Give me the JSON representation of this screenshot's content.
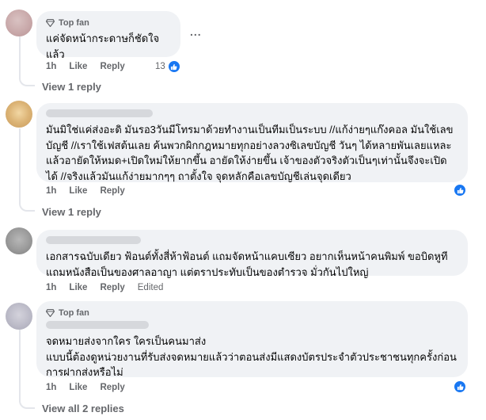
{
  "comments": [
    {
      "badge": "Top fan",
      "text": "แค่จัดหน้ากระดาษก็ชัดใจแล้ว",
      "time": "1h",
      "like": "Like",
      "reply": "Reply",
      "reactions": "13",
      "more": "..."
    },
    {
      "text": "มันมิใช่แค่ส่งอะดิ มันรอ3วันมีโทรมาด้วยทำงานเป็นทีมเป็นระบบ //แก้ง่ายๆแก๊งคอล มันใช้เลขบัญชี //เราใช้เฟสต้นเลย ค้นพวกผิกกฎหมายทุกอย่างลวงซิเลขบัญชี วันๆ ได้หลายพันเลยแหละ แล้วอายัดให้หมด+เปิดใหม่ให้ยากขึ้น อายัดให้ง่ายขึ้น เจ้าของตัวจริงตัวเป็นๆเท่านั้นจึงจะเปิดได้ //จริงแล้วมันแก้ง่ายมากๆๆ ถาตั้งใจ จุดหลักคือเลขบัญชีเล่นจุดเดียว",
      "time": "1h",
      "like": "Like",
      "reply": "Reply"
    },
    {
      "text": "เอกสารฉบับเดียว ฟ้อนต์ทั้งสี่ห้าฟ้อนต์ แถมจัดหน้าแคบเซียว อยากเห็นหน้าคนพิมพ์ ขอบิดหูทีแถมหนังสือเป็นของศาลอาญา แต่ตราประทับเป็นของตำรวจ มั่วกันไปใหญ่",
      "time": "1h",
      "like": "Like",
      "reply": "Reply",
      "edited": "Edited"
    },
    {
      "badge": "Top fan",
      "text": "จดหมายส่งจากใคร ใครเป็นคนมาส่ง\nแบบนี้ต้องดูหน่วยงานที่รับส่งจดหมายแล้วว่าตอนส่งมีแสดงบัตรประจำตัวประชาชนทุกครั้งก่อนการฝากส่งหรือไม่",
      "time": "1h",
      "like": "Like",
      "reply": "Reply"
    }
  ],
  "view_replies": [
    "View 1 reply",
    "View 1 reply",
    "View all 2 replies"
  ],
  "colors": {
    "like_blue": "#1877f2",
    "bubble": "#f0f2f5",
    "meta": "#65676b"
  },
  "icons": {
    "badge": "diamond-badge-icon",
    "reaction": "thumbs-up-icon"
  }
}
